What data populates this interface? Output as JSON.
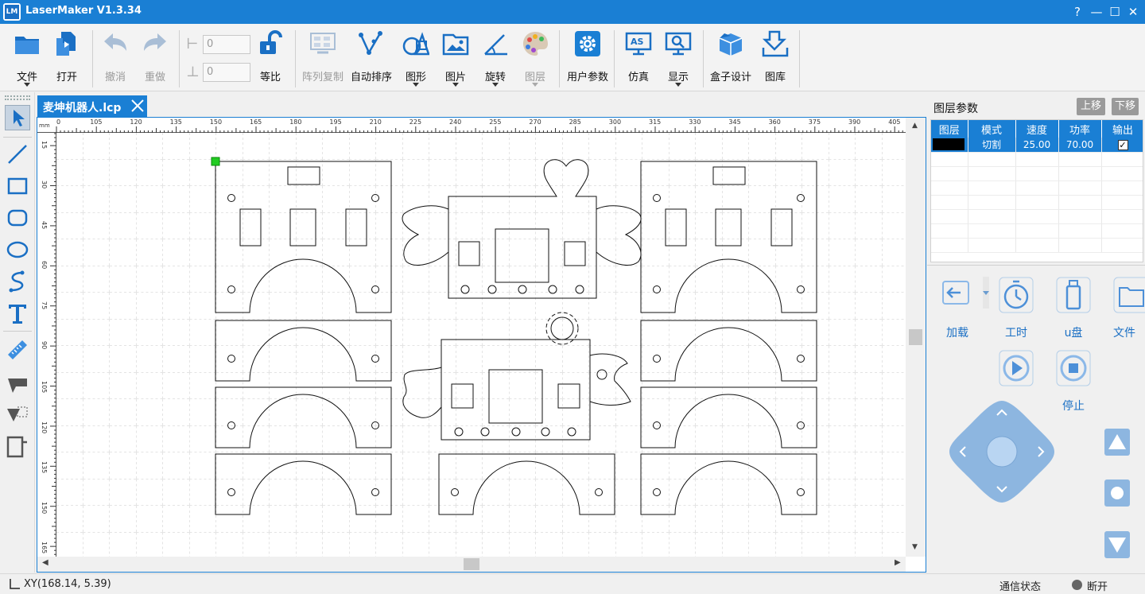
{
  "titlebar": {
    "logo_text": "LM",
    "title": "LaserMaker V1.3.34",
    "help": "?",
    "minimize": "—",
    "maximize": "☐",
    "close": "✕"
  },
  "toolbar": {
    "file": "文件",
    "open": "打开",
    "undo": "撤消",
    "redo": "重做",
    "width_value": "0",
    "height_value": "0",
    "proportional": "等比",
    "array_copy": "阵列复制",
    "auto_sort": "自动排序",
    "shape": "图形",
    "image": "图片",
    "rotate": "旋转",
    "layer": "图层",
    "user_params": "用户参数",
    "simulate": "仿真",
    "display": "显示",
    "box_design": "盒子设计",
    "library": "图库"
  },
  "document": {
    "tab_name": "麦坤机器人.lcp",
    "unit": "mm"
  },
  "rulers": {
    "top_ticks": [
      "0",
      "105",
      "120",
      "135",
      "150",
      "165",
      "180",
      "195",
      "210",
      "225",
      "240",
      "255",
      "270",
      "285",
      "300",
      "315",
      "330",
      "345",
      "360",
      "375",
      "390",
      "405"
    ],
    "left_ticks": [
      "15",
      "30",
      "45",
      "60",
      "75",
      "90",
      "105",
      "120",
      "135",
      "150",
      "165"
    ]
  },
  "layer_panel": {
    "title": "图层参数",
    "move_up": "上移",
    "move_down": "下移",
    "headers": [
      "图层",
      "模式",
      "速度",
      "功率",
      "输出"
    ],
    "rows": [
      {
        "color": "#000000",
        "mode": "切割",
        "speed": "25.00",
        "power": "70.00",
        "output": "✓"
      }
    ]
  },
  "controls": {
    "load": "加载",
    "work_time": "工时",
    "usb": "u盘",
    "file": "文件",
    "stop": "停止"
  },
  "status": {
    "coords": "XY(168.14, 5.39)",
    "comm_label": "通信状态",
    "connection": "断开"
  },
  "colors": {
    "accent": "#1a7fd4",
    "disconnected": "#666666",
    "marker": "#22cc22"
  }
}
